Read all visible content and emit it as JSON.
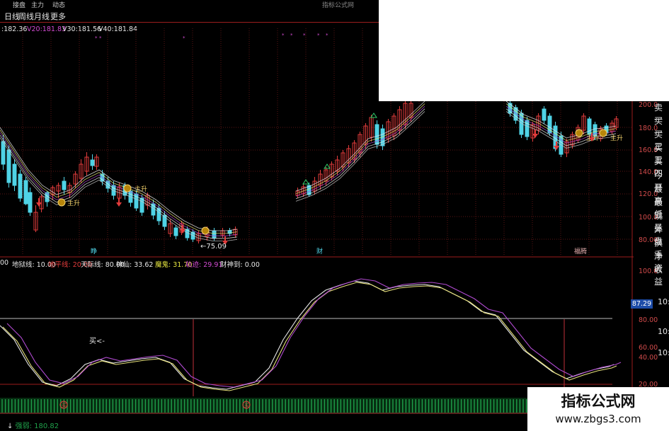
{
  "top_bar": {
    "items": [
      "",
      "接盘",
      "主力",
      "",
      "动态"
    ],
    "title_blur": "指标公式网"
  },
  "tabs": [
    "日线",
    "周线",
    "月线",
    "更多"
  ],
  "ma_legend": [
    {
      "label": ":182.36",
      "color": "#e6e6e6"
    },
    {
      "label": "V20:181.83",
      "color": "#d24bd2"
    },
    {
      "label": "V30:181.56",
      "color": "#e6e6e6"
    },
    {
      "label": "V40:181.84",
      "color": "#e6e6e6"
    }
  ],
  "indicator_legend": [
    {
      "label": "00",
      "color": "#e6e6e6"
    },
    {
      "label": "地狱线: 10.00",
      "color": "#e6e6e6"
    },
    {
      "label": "地平线: 20.00",
      "color": "#e23b3b"
    },
    {
      "label": "天际线: 80.00",
      "color": "#e6e6e6"
    },
    {
      "label": "神仙: 33.62",
      "color": "#e6e6e6"
    },
    {
      "label": "魔鬼: 31.70",
      "color": "#e6e640"
    },
    {
      "label": "轨迹: 29.91",
      "color": "#d24bd2"
    },
    {
      "label": "财神到: 0.00",
      "color": "#e6e6e6"
    }
  ],
  "price_axis": [
    "200.0",
    "180.0",
    "160.0",
    "140.0",
    "120.0",
    "100.0",
    "80.00"
  ],
  "indicator_axis": [
    "100.0",
    "80.00",
    "60.00",
    "40.00",
    "20.00"
  ],
  "indicator_current_value": "87.29",
  "right_labels": [
    "卖一",
    "买一",
    "买三",
    "买五",
    "买四",
    "今开",
    "最高",
    "最低",
    "现量",
    "外盘",
    "换手",
    "净资",
    "收益"
  ],
  "clock_labels": [
    "10:2",
    "10:",
    "10:"
  ],
  "chart_annotations": {
    "low_price": "75.09",
    "rise_label": "主升",
    "signal_buy": "买",
    "marker_labels": [
      "睁",
      "财",
      "福腾"
    ],
    "buy_text": "买<-"
  },
  "bottom_label": "强弱: 180.82",
  "watermark": {
    "title": "指标公式网",
    "url": "www.zbgs3.com"
  },
  "colors": {
    "grid_red": "#9b1d1d",
    "up_red": "#e23b3b",
    "down_cyan": "#4fd3e6",
    "ma_white": "#e6e6e6",
    "ma_purple": "#b04ad0",
    "ma_yellow": "#e6e07a",
    "bar_green": "#1fa04a"
  }
}
